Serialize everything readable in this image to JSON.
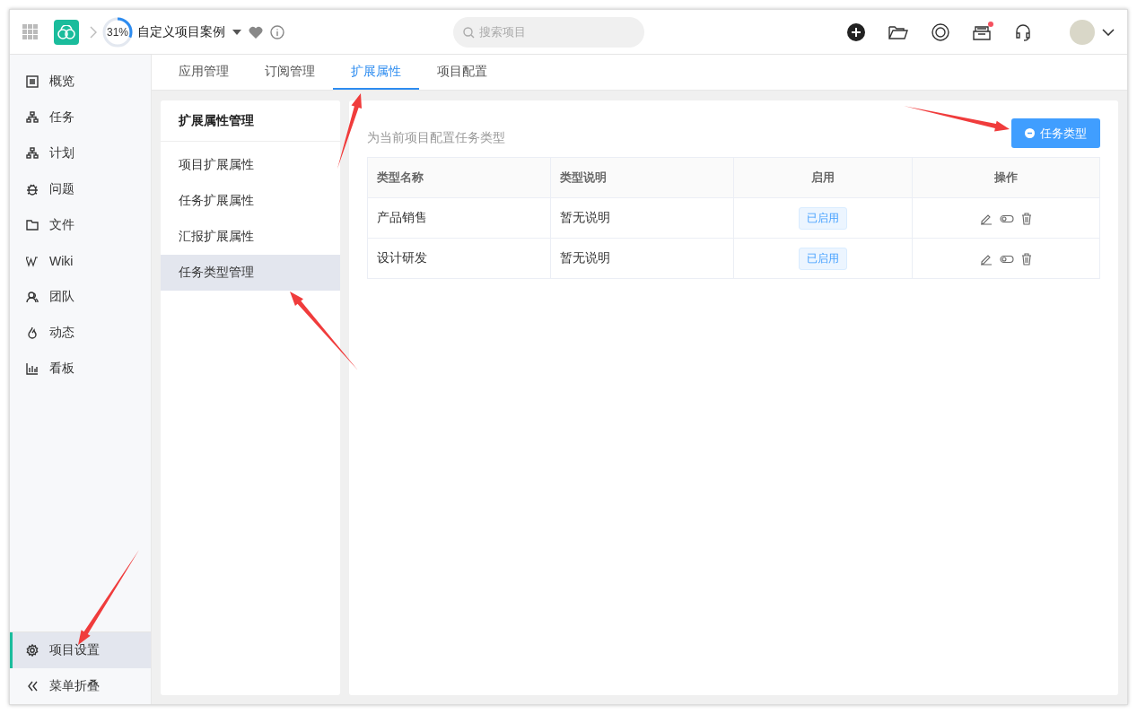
{
  "header": {
    "progress": {
      "label": "31%",
      "level": 0.31
    },
    "project_name": "自定义项目案例",
    "search": {
      "placeholder": "搜索项目"
    },
    "notification_dot": true
  },
  "sidebar": {
    "items": [
      {
        "label": "概览",
        "selected": false
      },
      {
        "label": "任务",
        "selected": false
      },
      {
        "label": "计划",
        "selected": false
      },
      {
        "label": "问题",
        "selected": false
      },
      {
        "label": "文件",
        "selected": false
      },
      {
        "label": "Wiki",
        "selected": false
      },
      {
        "label": "团队",
        "selected": false
      },
      {
        "label": "动态",
        "selected": false
      },
      {
        "label": "看板",
        "selected": false
      }
    ],
    "settings": {
      "label": "项目设置",
      "selected": true
    },
    "collapse": {
      "label": "菜单折叠"
    }
  },
  "tabs": [
    {
      "label": "应用管理",
      "selected": false
    },
    {
      "label": "订阅管理",
      "selected": false
    },
    {
      "label": "扩展属性",
      "selected": true
    },
    {
      "label": "项目配置",
      "selected": false
    }
  ],
  "submenu": {
    "title": "扩展属性管理",
    "items": [
      {
        "label": "项目扩展属性",
        "selected": false
      },
      {
        "label": "任务扩展属性",
        "selected": false
      },
      {
        "label": "汇报扩展属性",
        "selected": false
      },
      {
        "label": "任务类型管理",
        "selected": true
      }
    ]
  },
  "main": {
    "description": "为当前项目配置任务类型",
    "add_button": "任务类型",
    "table": {
      "columns": [
        "类型名称",
        "类型说明",
        "启用",
        "操作"
      ],
      "rows": [
        {
          "name": "产品销售",
          "description": "暂无说明",
          "status": "已启用",
          "enabled": true
        },
        {
          "name": "设计研发",
          "description": "暂无说明",
          "status": "已启用",
          "enabled": true
        }
      ]
    }
  }
}
